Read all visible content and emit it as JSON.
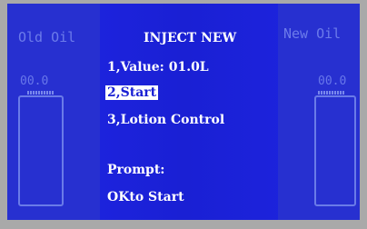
{
  "screen": {
    "left_panel": {
      "title": "Old Oil",
      "value": "00.0"
    },
    "right_panel": {
      "title": "New Oil",
      "value": "00.0"
    },
    "menu": {
      "title": "INJECT NEW",
      "item1": "1,Value: 01.0L",
      "item2": "2,Start",
      "item3": "3,Lotion Control",
      "prompt_label": "Prompt:",
      "prompt_text": "OKto Start"
    },
    "colors": {
      "screen_blue": "#1a20d4",
      "text_white": "#ffffff",
      "dim_text": "#6c7bea",
      "highlight": "#ffffff"
    }
  }
}
